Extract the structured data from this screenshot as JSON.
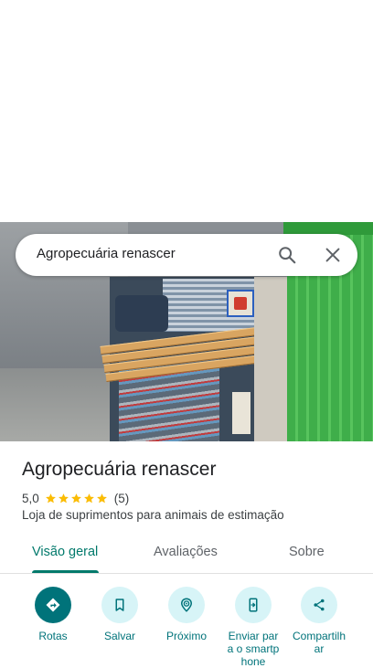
{
  "search": {
    "query": "Agropecuária renascer"
  },
  "place": {
    "name": "Agropecuária renascer",
    "rating": "5,0",
    "stars": 5,
    "reviews_count": "(5)",
    "category": "Loja de suprimentos para animais de estimação"
  },
  "tabs": [
    {
      "label": "Visão geral",
      "active": true
    },
    {
      "label": "Avaliações",
      "active": false
    },
    {
      "label": "Sobre",
      "active": false
    }
  ],
  "actions": [
    {
      "label": "Rotas",
      "icon": "directions-icon"
    },
    {
      "label": "Salvar",
      "icon": "bookmark-icon"
    },
    {
      "label": "Próximo",
      "icon": "nearby-icon"
    },
    {
      "label": "Enviar para o smartphone",
      "icon": "send-to-phone-icon"
    },
    {
      "label": "Compartilhar",
      "icon": "share-icon"
    }
  ],
  "colors": {
    "accent": "#00796b",
    "action_primary": "#00737a",
    "action_secondary_bg": "#d7f4f7",
    "star": "#fbbc04"
  }
}
